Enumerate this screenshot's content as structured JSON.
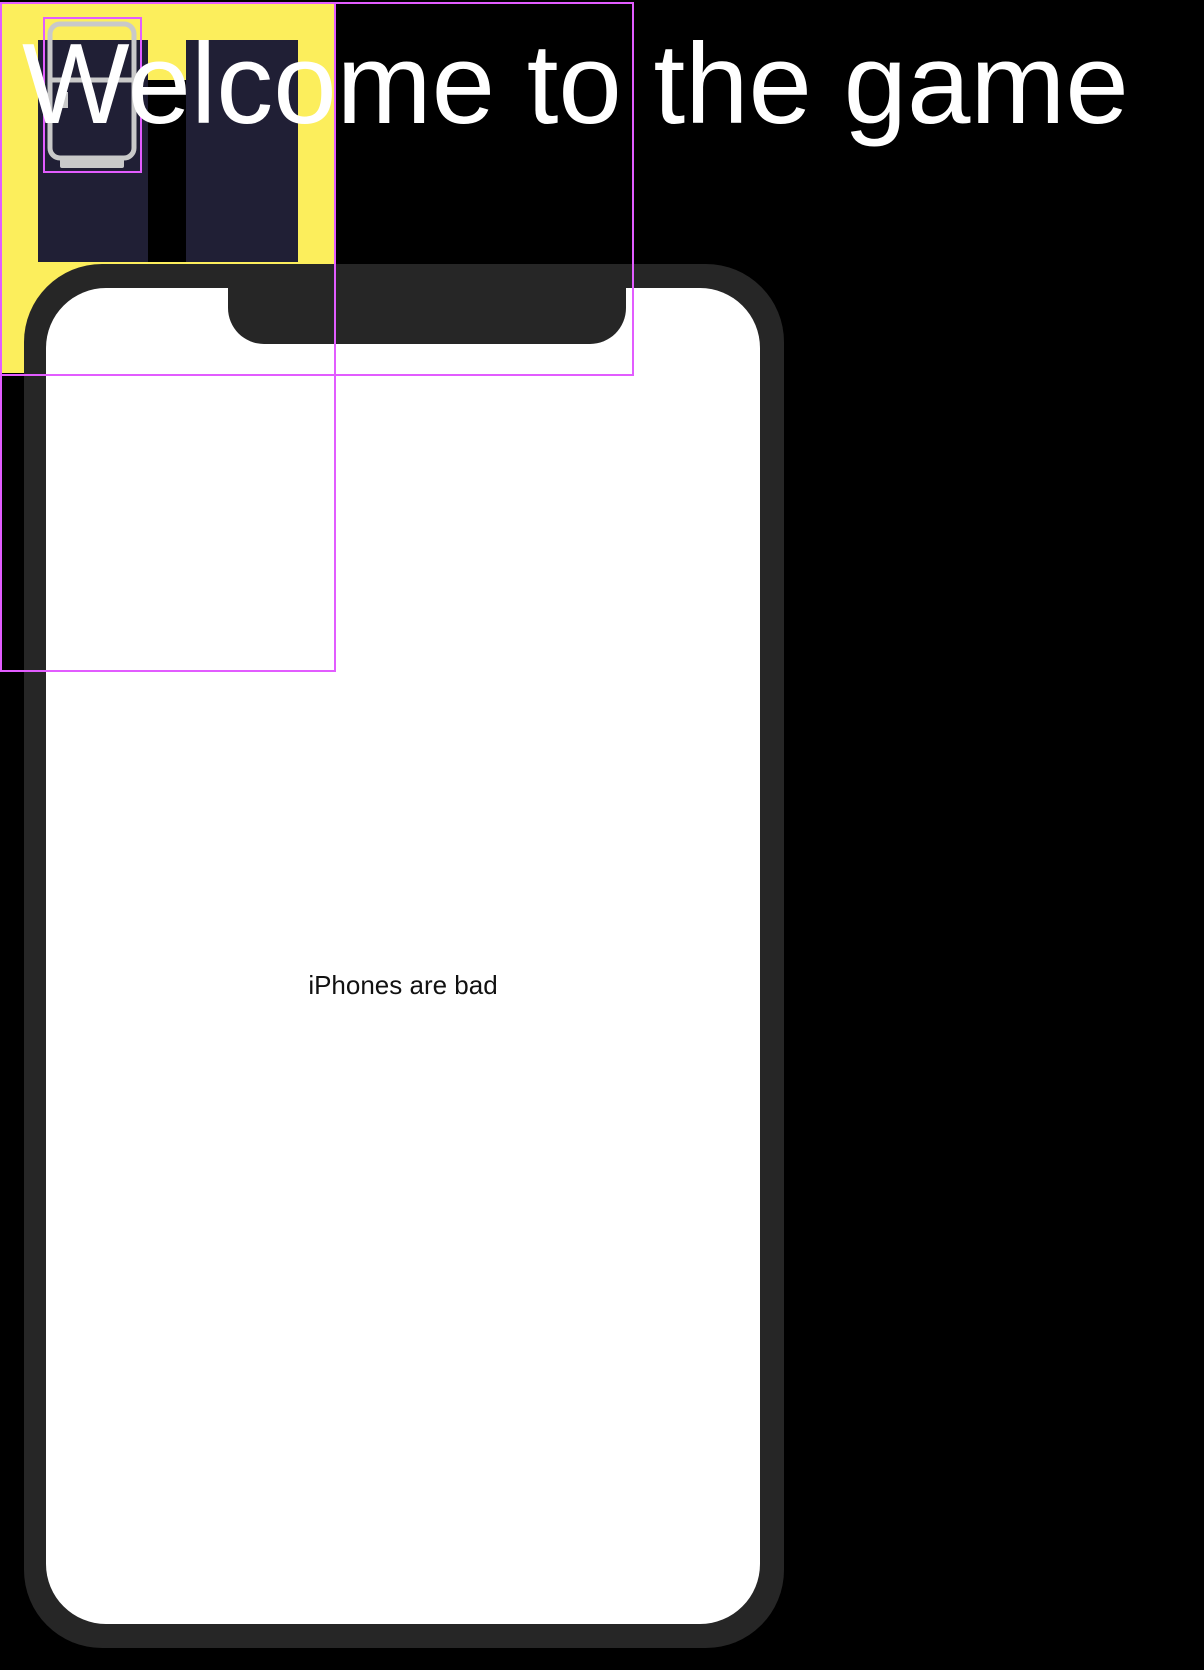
{
  "header": {
    "title": "Welcome to the game"
  },
  "phone": {
    "caption": "iPhones are bad"
  },
  "icons": {
    "device": "phone-device-icon"
  },
  "colors": {
    "background": "#000000",
    "tile": "#fcee5c",
    "column": "#201f35",
    "phone_frame": "#262626",
    "phone_screen": "#ffffff",
    "selection": "#e25cff",
    "title_text": "#ffffff"
  }
}
